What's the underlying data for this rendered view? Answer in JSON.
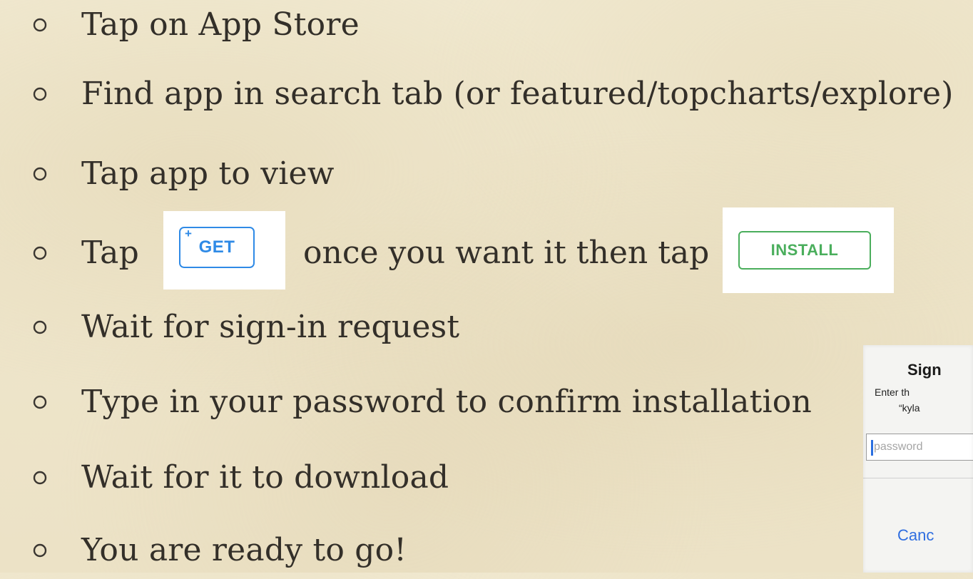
{
  "colors": {
    "background": "#efe6cc",
    "text": "#332f29",
    "bullet": "#3a3631",
    "get_blue": "#2f8ae6",
    "install_green": "#4aae5c",
    "cancel_blue": "#2f6ee0"
  },
  "bullet_icon": "hollow-circle-icon",
  "steps": [
    {
      "text": "Tap on App Store"
    },
    {
      "text": "Find app in search tab (or featured/topcharts/explore)"
    },
    {
      "text": "Tap app to view"
    },
    {
      "text": "Tap",
      "after_text": "once you want it then tap"
    },
    {
      "text": "Wait for sign-in request"
    },
    {
      "text": "Type in your password to confirm installation"
    },
    {
      "text": "Wait for it to download"
    },
    {
      "text": "You are ready to go!"
    }
  ],
  "get_button": {
    "plus": "+",
    "label": "GET"
  },
  "install_button": {
    "label": "INSTALL"
  },
  "signin_dialog": {
    "title": "Sign",
    "message_line1": "Enter th",
    "message_line2": "“kyla",
    "password_placeholder": "password",
    "cancel_label": "Canc"
  }
}
